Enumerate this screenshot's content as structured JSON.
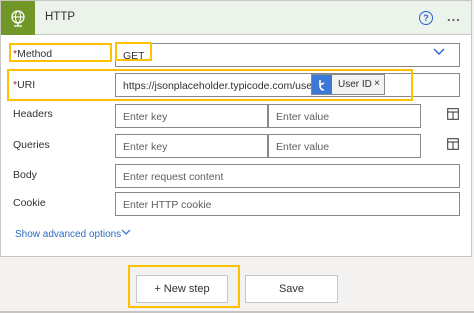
{
  "header": {
    "title": "HTTP",
    "help_label": "?",
    "more_label": "..."
  },
  "method": {
    "label": "Method",
    "value": "GET"
  },
  "uri": {
    "label": "URI",
    "value": "https://jsonplaceholder.typicode.com/users/",
    "token": {
      "label": "User ID",
      "remove": "×"
    }
  },
  "headers": {
    "label": "Headers",
    "key_placeholder": "Enter key",
    "value_placeholder": "Enter value"
  },
  "queries": {
    "label": "Queries",
    "key_placeholder": "Enter key",
    "value_placeholder": "Enter value"
  },
  "body": {
    "label": "Body",
    "placeholder": "Enter request content"
  },
  "cookie": {
    "label": "Cookie",
    "placeholder": "Enter HTTP cookie"
  },
  "advanced": {
    "label": "Show advanced options"
  },
  "footer": {
    "new_step_label": "+ New step",
    "save_label": "Save"
  },
  "colors": {
    "app_icon": "#709727",
    "header_bg": "#ebf3eb",
    "highlight": "#ffc000",
    "link": "#2b6cc4",
    "token_icon": "#3b78d8"
  }
}
